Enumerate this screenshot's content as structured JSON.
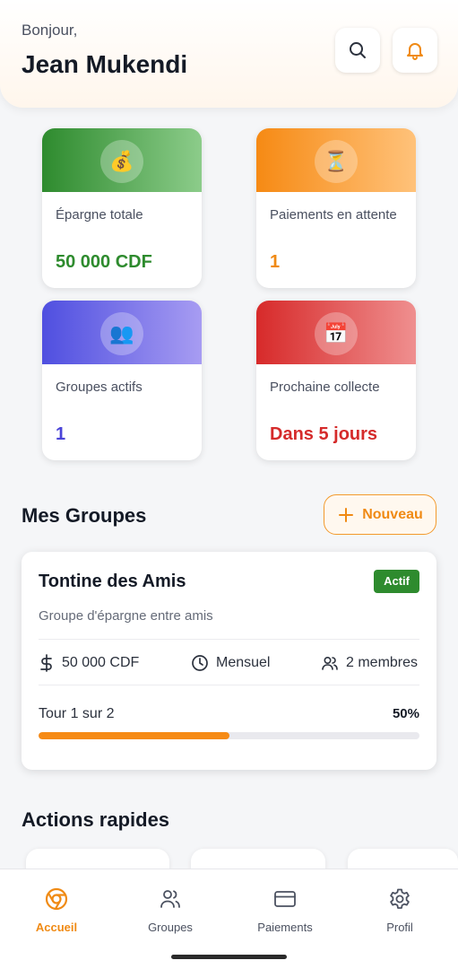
{
  "header": {
    "greeting": "Bonjour,",
    "user_name": "Jean Mukendi"
  },
  "stats": [
    {
      "icon": "money-bag-icon",
      "glyph": "💰",
      "label": "Épargne totale",
      "value": "50 000 CDF",
      "color": "#2e8b2e"
    },
    {
      "icon": "hourglass-icon",
      "glyph": "⏳",
      "label": "Paiements en attente",
      "value": "1",
      "color": "#f08a14"
    },
    {
      "icon": "people-icon",
      "glyph": "👥",
      "label": "Groupes actifs",
      "value": "1",
      "color": "#4a44d8"
    },
    {
      "icon": "calendar-icon",
      "glyph": "📅",
      "label": "Prochaine collecte",
      "value": "Dans 5 jours",
      "color": "#d52b2b"
    }
  ],
  "groups_section": {
    "title": "Mes Groupes",
    "new_button_label": "Nouveau"
  },
  "group_card": {
    "name": "Tontine des Amis",
    "status": "Actif",
    "description": "Groupe d'épargne entre amis",
    "amount": "50 000 CDF",
    "frequency": "Mensuel",
    "members": "2 membres",
    "round_text": "Tour 1 sur 2",
    "progress_label": "50%",
    "progress": 0.5
  },
  "quick_actions": {
    "title": "Actions rapides"
  },
  "bottom_nav": {
    "items": [
      {
        "label": "Accueil",
        "icon": "home-icon",
        "active": true
      },
      {
        "label": "Groupes",
        "icon": "users-icon",
        "active": false
      },
      {
        "label": "Paiements",
        "icon": "credit-card-icon",
        "active": false
      },
      {
        "label": "Profil",
        "icon": "gear-icon",
        "active": false
      }
    ]
  },
  "colors": {
    "accent": "#f08a14",
    "success": "#2e8b2e",
    "indigo": "#4a44d8",
    "danger": "#d52b2b"
  }
}
